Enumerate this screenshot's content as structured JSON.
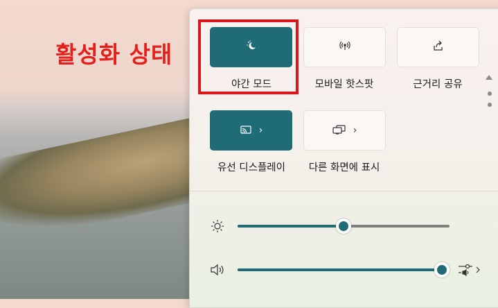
{
  "annotation": {
    "text": "활성화 상태"
  },
  "tiles": [
    {
      "label": "야간 모드",
      "icon": "night-light-icon",
      "active": true
    },
    {
      "label": "모바일 핫스팟",
      "icon": "mobile-hotspot-icon",
      "active": false
    },
    {
      "label": "근거리 공유",
      "icon": "nearby-share-icon",
      "active": false
    },
    {
      "label": "유선 디스플레이",
      "icon": "cast-icon",
      "active": true
    },
    {
      "label": "다른 화면에 표시",
      "icon": "project-icon",
      "active": false
    }
  ],
  "brightness": {
    "icon": "sun-icon",
    "level": 0.5
  },
  "volume": {
    "icon": "speaker-icon",
    "level": 1.0,
    "mixer_icon": "volume-mixer-icon"
  },
  "colors": {
    "accent": "#1f6b76",
    "highlight": "#d9161c"
  }
}
